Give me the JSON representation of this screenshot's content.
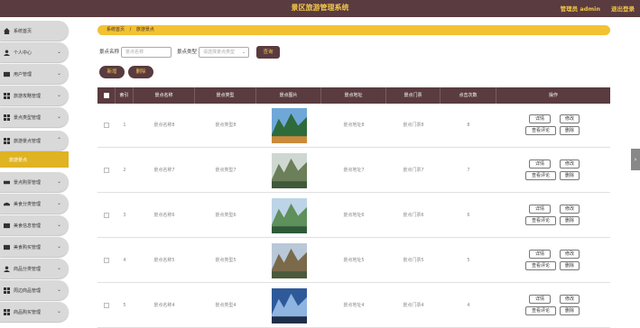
{
  "header": {
    "title": "景区旅游管理系统",
    "admin": "管理员 admin",
    "logout": "退出登录"
  },
  "sidebar": {
    "items": [
      {
        "label": "系统首页",
        "icon": "home-icon",
        "chevron": false
      },
      {
        "label": "个人中心",
        "icon": "user-icon",
        "chevron": true
      },
      {
        "label": "用户管理",
        "icon": "users-icon",
        "chevron": true
      },
      {
        "label": "旅游攻略管理",
        "icon": "grid-icon",
        "chevron": true
      },
      {
        "label": "景点类型管理",
        "icon": "grid-icon",
        "chevron": true
      },
      {
        "label": "旅游景点管理",
        "icon": "grid-icon",
        "chevron": true
      },
      {
        "label": "景点购票管理",
        "icon": "ticket-icon",
        "chevron": true
      },
      {
        "label": "美食分类管理",
        "icon": "food-icon",
        "chevron": true
      },
      {
        "label": "美食信息管理",
        "icon": "food-icon",
        "chevron": true
      },
      {
        "label": "美食购买管理",
        "icon": "food-icon",
        "chevron": true
      },
      {
        "label": "商品分类管理",
        "icon": "user-icon",
        "chevron": true
      },
      {
        "label": "周边商品管理",
        "icon": "grid-icon",
        "chevron": true
      },
      {
        "label": "商品购买管理",
        "icon": "grid-icon",
        "chevron": true
      }
    ],
    "active_sub": "旅游景点"
  },
  "breadcrumb": {
    "home": "系统首页",
    "current": "旅游景点"
  },
  "search": {
    "name_label": "景点名称",
    "name_placeholder": "景点名称",
    "type_label": "景点类型",
    "type_placeholder": "请选择景点类型",
    "search_button": "查询"
  },
  "actions": {
    "add": "新增",
    "delete": "删除"
  },
  "table": {
    "columns": [
      "索引",
      "景点名称",
      "景点类型",
      "景点图片",
      "景点地址",
      "景点门票",
      "点击次数",
      "操作"
    ],
    "rows": [
      {
        "index": "1",
        "name": "景点名称8",
        "type": "景点类型8",
        "address": "景点地址8",
        "ticket": "景点门票8",
        "clicks": "8"
      },
      {
        "index": "2",
        "name": "景点名称7",
        "type": "景点类型7",
        "address": "景点地址7",
        "ticket": "景点门票7",
        "clicks": "7"
      },
      {
        "index": "3",
        "name": "景点名称6",
        "type": "景点类型6",
        "address": "景点地址6",
        "ticket": "景点门票6",
        "clicks": "6"
      },
      {
        "index": "4",
        "name": "景点名称5",
        "type": "景点类型5",
        "address": "景点地址5",
        "ticket": "景点门票5",
        "clicks": "5"
      },
      {
        "index": "5",
        "name": "景点名称4",
        "type": "景点类型4",
        "address": "景点地址4",
        "ticket": "景点门票4",
        "clicks": "4"
      }
    ],
    "ops": {
      "detail": "详情",
      "edit": "修改",
      "review": "查看评论",
      "delete": "删除"
    }
  },
  "colors": {
    "primary": "#5a3b3f",
    "accent": "#f2c233",
    "gold_text": "#f0c64a"
  }
}
